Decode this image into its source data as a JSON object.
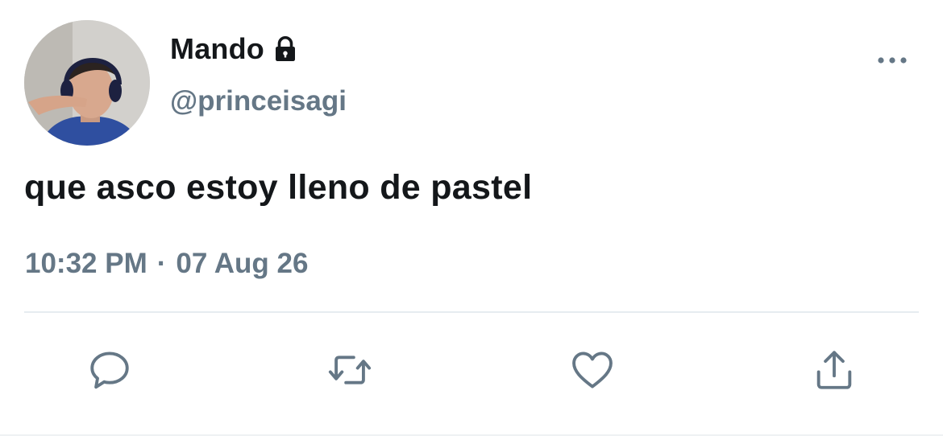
{
  "user": {
    "display_name": "Mando",
    "handle": "@princeisagi",
    "protected_icon": "lock-icon"
  },
  "tweet": {
    "text": "que asco estoy lleno de pastel",
    "time": "10:32 PM",
    "separator": "·",
    "date": "07 Aug 26"
  },
  "actions": [
    {
      "name": "reply",
      "icon": "speech-bubble-icon"
    },
    {
      "name": "retweet",
      "icon": "retweet-arrows-icon"
    },
    {
      "name": "like",
      "icon": "heart-icon"
    },
    {
      "name": "share",
      "icon": "share-upload-icon"
    }
  ],
  "colors": {
    "text_primary": "#14171a",
    "text_secondary": "#657786",
    "divider": "#e6ecf0",
    "background": "#ffffff"
  }
}
